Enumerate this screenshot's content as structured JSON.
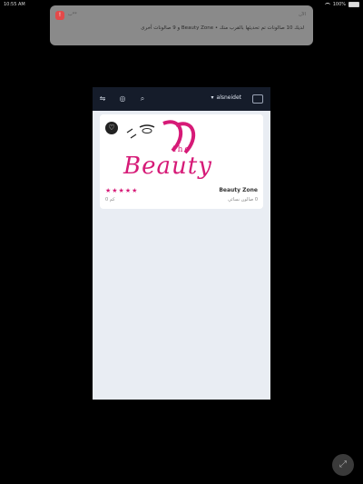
{
  "status_bar": {
    "time": "10:55 AM",
    "right_text": "100%"
  },
  "notification": {
    "app_name": "ب**",
    "time": "الآن",
    "body": "لديك 10 صالونات تم تحديثها بالقرب منك • Beauty Zone و 9 صالونات أخرى"
  },
  "app": {
    "topbar": {
      "title": "alsneidet"
    },
    "card": {
      "logo_the": "the",
      "logo_text": "Beauty",
      "rating": "★★★★★",
      "name": "Beauty Zone",
      "sub_left": "0 كم",
      "sub_right": "0 صالون نسائي"
    }
  }
}
